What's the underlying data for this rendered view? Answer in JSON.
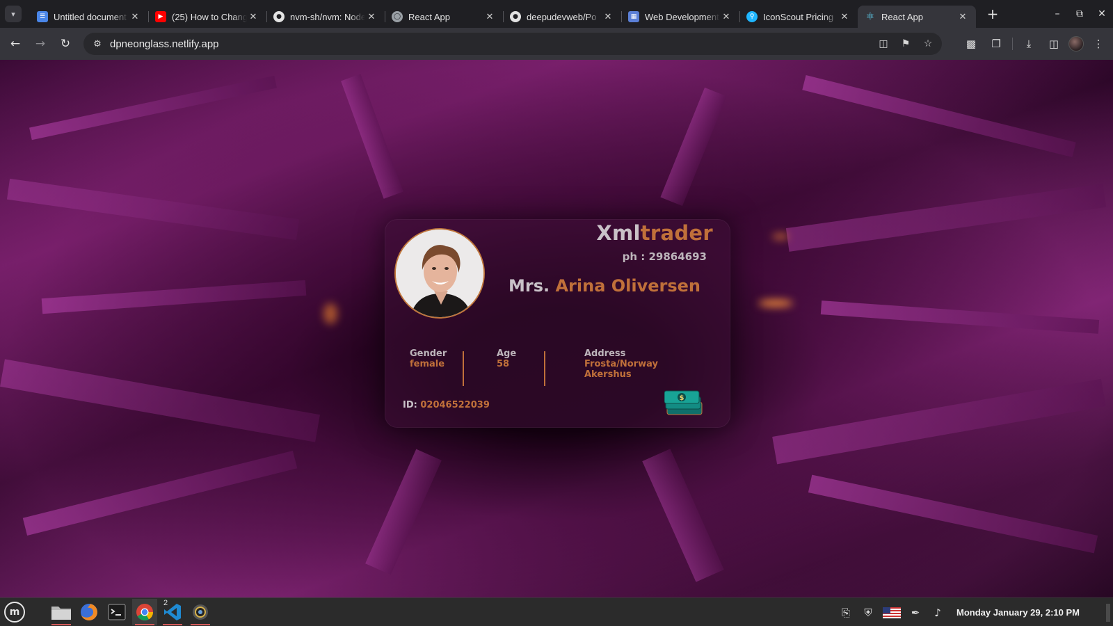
{
  "browser": {
    "tabs": [
      {
        "title": "Untitled document",
        "icon": "docs-icon",
        "color": "#4a86e8"
      },
      {
        "title": "(25) How to Change",
        "icon": "youtube-icon",
        "color": "#ff0000"
      },
      {
        "title": "nvm-sh/nvm: Node",
        "icon": "github-icon",
        "color": "#e3e3e3"
      },
      {
        "title": "React App",
        "icon": "globe-icon",
        "color": "#9aa0a6"
      },
      {
        "title": "deepudevweb/Po",
        "icon": "github-icon",
        "color": "#e3e3e3"
      },
      {
        "title": "Web Development",
        "icon": "page-icon",
        "color": "#5b7fd6"
      },
      {
        "title": "IconScout Pricing",
        "icon": "iconscout-icon",
        "color": "#1fb6ff"
      },
      {
        "title": "React App",
        "icon": "react-icon",
        "color": "#61dafb"
      }
    ],
    "active_tab_index": 7,
    "url": "dpneonglass.netlify.app"
  },
  "card": {
    "brand_part1": "Xml",
    "brand_part2": "trader",
    "phone": "ph : 29864693",
    "name_title": "Mrs.",
    "name_full": "Arina Oliversen",
    "gender_label": "Gender",
    "gender_value": "female",
    "age_label": "Age",
    "age_value": "58",
    "address_label": "Address",
    "address_line1": "Frosta/Norway",
    "address_line2": "Akershus",
    "id_label": "ID:",
    "id_value": "02046522039",
    "accent_color": "#c0703a"
  },
  "taskbar": {
    "launchers": [
      "files-icon",
      "firefox-icon",
      "terminal-icon",
      "chrome-icon",
      "vscode-icon",
      "screenshot-icon"
    ],
    "vscode_badge": "2",
    "clock": "Monday January 29,  2:10 PM"
  }
}
